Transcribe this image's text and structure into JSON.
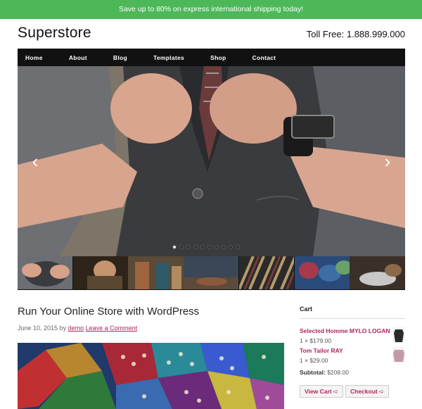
{
  "topbar": {
    "text": "Save up to 80% on express international shipping today!"
  },
  "header": {
    "site_title": "Superstore",
    "toll_free": "Toll Free: 1.888.999.000"
  },
  "nav": {
    "items": [
      "Home",
      "About",
      "Blog",
      "Templates",
      "Shop",
      "Contact"
    ]
  },
  "slider": {
    "prev_icon": "‹",
    "next_icon": "›",
    "dot_count": 10,
    "active_dot": 0
  },
  "post": {
    "title": "Run Your Online Store with WordPress",
    "date": "June 10, 2015",
    "by": "by",
    "author": "demo",
    "comment_link": "Leave a Comment"
  },
  "cart": {
    "heading": "Cart",
    "items": [
      {
        "name": "Selected Homme MYLO LOGAN",
        "qty": "1 × $179.00"
      },
      {
        "name": "Tom Tailor RAY",
        "qty": "1 × $29.00"
      }
    ],
    "subtotal_label": "Subtotal:",
    "subtotal_value": "$208.00",
    "view_cart": "View Cart",
    "checkout": "Checkout",
    "button_icon": "➪"
  }
}
